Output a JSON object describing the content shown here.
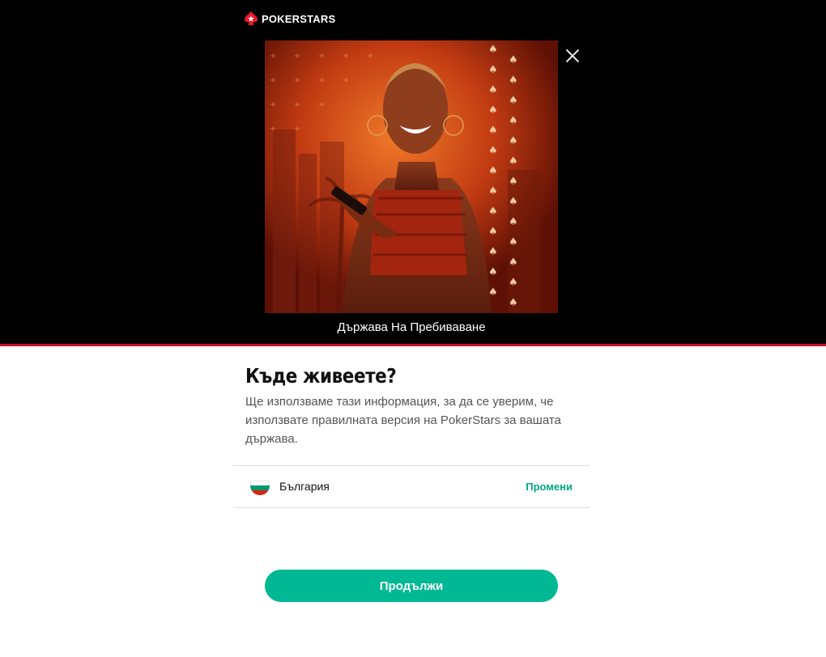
{
  "header": {
    "brand": "POKERSTARS",
    "logo_icon": "pokerstars-spade-star-icon",
    "close_icon": "close-icon"
  },
  "hero": {
    "image": "promo-woman-smiling-phone",
    "caption": "Държава На Пребиваване"
  },
  "main": {
    "heading": "Къде живеете?",
    "description": "Ще използваме тази информация, за да се уверим, че използвате правилната версия на PokerStars за вашата държава."
  },
  "country": {
    "name": "България",
    "flag_icon": "bulgaria-flag-icon",
    "flag_colors": [
      "#ffffff",
      "#00966e",
      "#d62612"
    ],
    "change_label": "Промени"
  },
  "actions": {
    "continue_label": "Продължи"
  },
  "colors": {
    "accent": "#00b894",
    "brand_red": "#c8102e",
    "header_bg": "#000000"
  }
}
